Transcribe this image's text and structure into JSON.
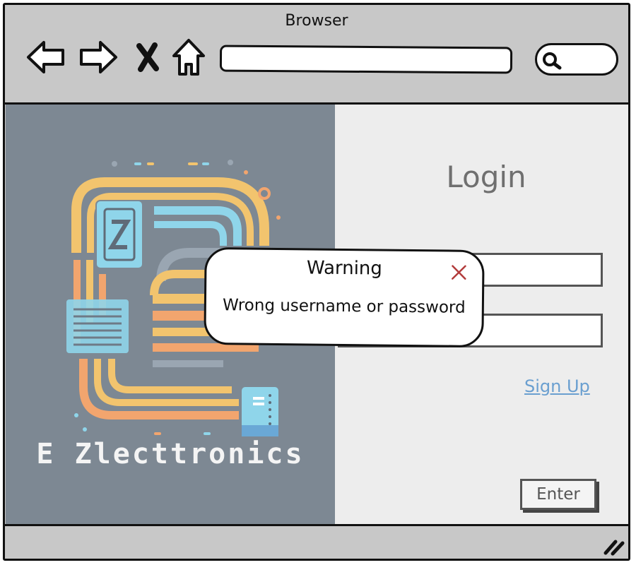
{
  "browser": {
    "title": "Browser",
    "icons": {
      "back": "arrow-left-icon",
      "forward": "arrow-right-icon",
      "stop": "close-icon",
      "home": "home-icon",
      "search": "search-icon",
      "resize": "resize-grip-icon"
    },
    "url_value": ""
  },
  "left_panel": {
    "brand_text": "E Zlecttronics"
  },
  "login": {
    "title": "Login",
    "username_value": "",
    "password_value": "",
    "signup_label": "Sign Up",
    "enter_label": "Enter"
  },
  "dialog": {
    "title": "Warning",
    "message": "Wrong username or password"
  },
  "colors": {
    "left_panel_bg": "#7d8893",
    "right_panel_bg": "#ededed",
    "link": "#6a9fd0",
    "close_x": "#b23b3b"
  }
}
